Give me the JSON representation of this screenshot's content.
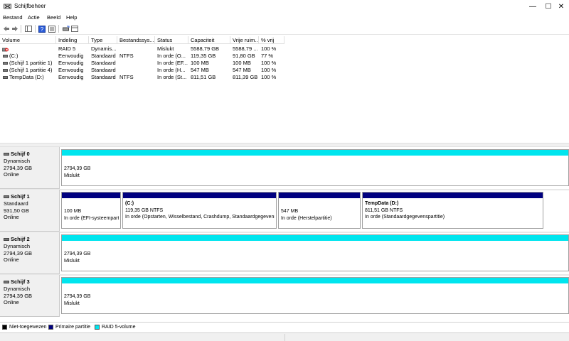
{
  "window": {
    "title": "Schijfbeheer",
    "minimize": "—",
    "maximize": "☐",
    "close": "✕"
  },
  "menu": {
    "items": [
      "Bestand",
      "Actie",
      "Beeld",
      "Help"
    ]
  },
  "toolbar": {
    "icons": [
      "back-arrow-icon",
      "forward-arrow-icon",
      "console-tree-icon",
      "help-icon",
      "properties-icon",
      "disk-connect-icon",
      "list-view-icon"
    ]
  },
  "volume_table": {
    "columns": [
      "Volume",
      "Indeling",
      "Type",
      "Bestandssys...",
      "Status",
      "Capaciteit",
      "Vrije ruim...",
      "% vrij"
    ],
    "rows": [
      {
        "volume": "",
        "layout": "RAID 5",
        "type": "Dynamis...",
        "fs": "",
        "status": "Mislukt",
        "capacity": "5588,79 GB",
        "free": "5588,79 ...",
        "pct": "100 %",
        "icon": "failed-volume-icon"
      },
      {
        "volume": "(C:)",
        "layout": "Eenvoudig",
        "type": "Standaard",
        "fs": "NTFS",
        "status": "In orde (O...",
        "capacity": "119,35 GB",
        "free": "91,80 GB",
        "pct": "77 %",
        "icon": "volume-icon"
      },
      {
        "volume": "(Schijf 1 partitie 1)",
        "layout": "Eenvoudig",
        "type": "Standaard",
        "fs": "",
        "status": "In orde (EF...",
        "capacity": "100 MB",
        "free": "100 MB",
        "pct": "100 %",
        "icon": "volume-icon"
      },
      {
        "volume": "(Schijf 1 partitie 4)",
        "layout": "Eenvoudig",
        "type": "Standaard",
        "fs": "",
        "status": "In orde (H...",
        "capacity": "547 MB",
        "free": "547 MB",
        "pct": "100 %",
        "icon": "volume-icon"
      },
      {
        "volume": "TempData (D:)",
        "layout": "Eenvoudig",
        "type": "Standaard",
        "fs": "NTFS",
        "status": "In orde (St...",
        "capacity": "811,51 GB",
        "free": "811,39 GB",
        "pct": "100 %",
        "icon": "volume-icon"
      }
    ]
  },
  "disks": [
    {
      "name": "Schijf 0",
      "kind": "Dynamisch",
      "size": "2794,39 GB",
      "state": "Online",
      "partitions": [
        {
          "title": "",
          "line1": "2794,39 GB",
          "line2": "Mislukt",
          "color": "#00e5ee"
        }
      ]
    },
    {
      "name": "Schijf 1",
      "kind": "Standaard",
      "size": "931,50 GB",
      "state": "Online",
      "partitions": [
        {
          "title": "",
          "line1": "100 MB",
          "line2": "In orde (EFI-systeempartitie)",
          "color": "#00007f"
        },
        {
          "title": "(C:)",
          "line1": "119,35 GB NTFS",
          "line2": "In orde (Opstarten, Wisselbestand, Crashdump, Standaardgegevenspartitie)",
          "color": "#00007f"
        },
        {
          "title": "",
          "line1": "547 MB",
          "line2": "In orde (Herstelpartitie)",
          "color": "#00007f"
        },
        {
          "title": "TempData  (D:)",
          "line1": "811,51 GB NTFS",
          "line2": "In orde (Standaardgegevenspartitie)",
          "color": "#00007f"
        }
      ]
    },
    {
      "name": "Schijf 2",
      "kind": "Dynamisch",
      "size": "2794,39 GB",
      "state": "Online",
      "partitions": [
        {
          "title": "",
          "line1": "2794,39 GB",
          "line2": "Mislukt",
          "color": "#00e5ee"
        }
      ]
    },
    {
      "name": "Schijf 3",
      "kind": "Dynamisch",
      "size": "2794,39 GB",
      "state": "Online",
      "partitions": [
        {
          "title": "",
          "line1": "2794,39 GB",
          "line2": "Mislukt",
          "color": "#00e5ee"
        }
      ]
    }
  ],
  "legend": [
    {
      "label": "Niet-toegewezen",
      "color": "#000000"
    },
    {
      "label": "Primaire partitie",
      "color": "#00007f"
    },
    {
      "label": "RAID 5-volume",
      "color": "#00e5ee"
    }
  ]
}
